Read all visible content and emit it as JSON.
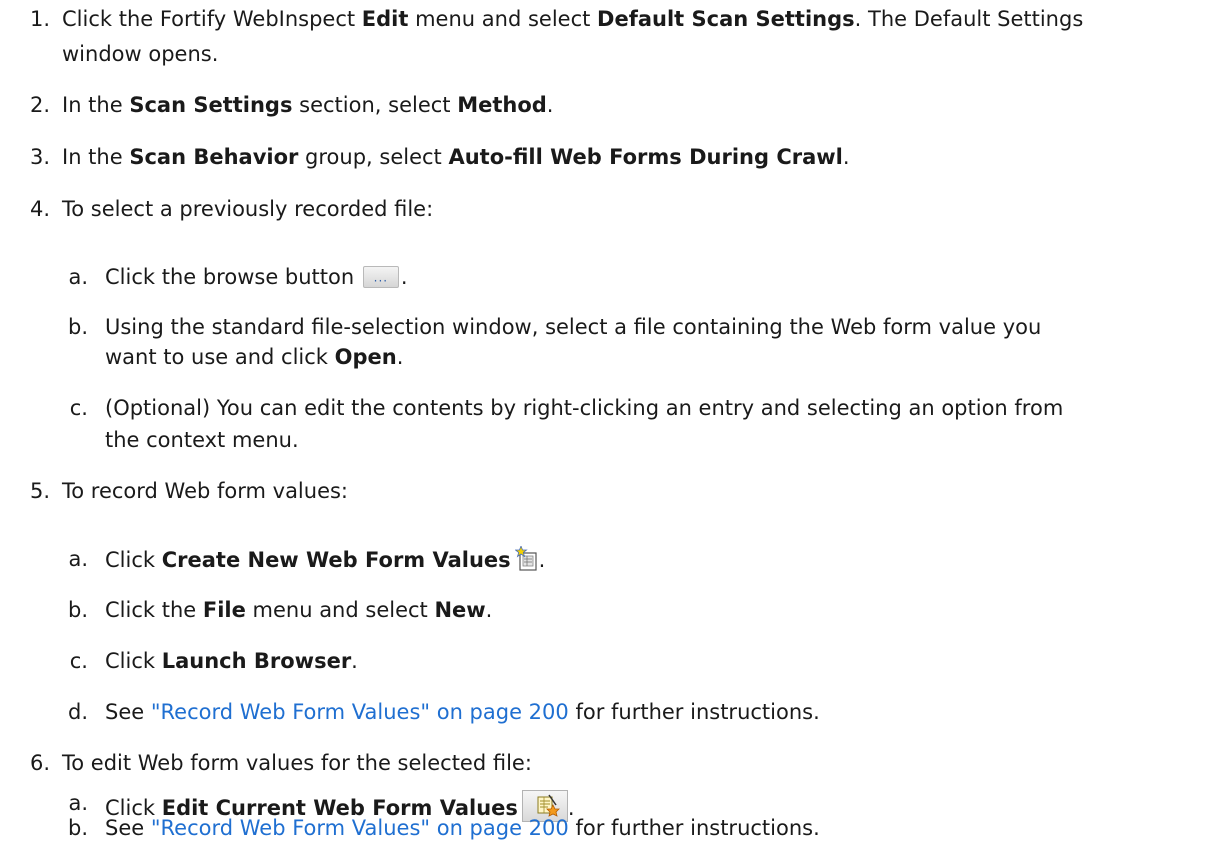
{
  "steps": {
    "s1": {
      "num": "1.",
      "p1": "Click the Fortify WebInspect ",
      "b1": "Edit",
      "p2": " menu and select ",
      "b2": "Default Scan Settings",
      "p3": ". The Default Settings",
      "cont": "window opens."
    },
    "s2": {
      "num": "2.",
      "p1": "In the ",
      "b1": "Scan Settings",
      "p2": " section, select ",
      "b2": "Method",
      "p3": "."
    },
    "s3": {
      "num": "3.",
      "p1": "In the ",
      "b1": "Scan Behavior",
      "p2": " group, select ",
      "b2": "Auto-fill Web Forms During Crawl",
      "p3": "."
    },
    "s4": {
      "num": "4.",
      "text": "To select a previously recorded file:",
      "a": {
        "letter": "a.",
        "p1": "Click the browse button ",
        "p2": "."
      },
      "b": {
        "letter": "b.",
        "p1": "Using the standard file-selection window, select a file containing the Web form value you",
        "cont1": "want to use and click ",
        "cb": "Open",
        "cont2": "."
      },
      "c": {
        "letter": "c.",
        "p1": "(Optional) You can edit the contents by right-clicking an entry and selecting an option from",
        "cont": "the context menu."
      }
    },
    "s5": {
      "num": "5.",
      "text": "To record Web form values:",
      "a": {
        "letter": "a.",
        "p1": "Click ",
        "b1": "Create New Web Form Values",
        "p2": "."
      },
      "b": {
        "letter": "b.",
        "p1": "Click the ",
        "b1": "File",
        "p2": " menu and select ",
        "b2": "New",
        "p3": "."
      },
      "c": {
        "letter": "c.",
        "p1": "Click ",
        "b1": "Launch Browser",
        "p2": "."
      },
      "d": {
        "letter": "d.",
        "p1": "See ",
        "link": "\"Record Web Form Values\" on page 200",
        "p2": " for further instructions."
      }
    },
    "s6": {
      "num": "6.",
      "text": "To edit Web form values for the selected file:",
      "a": {
        "letter": "a.",
        "p1": "Click ",
        "b1": "Edit Current Web Form Values",
        "p2": "."
      },
      "b": {
        "letter": "b.",
        "p1": "See ",
        "link": "\"Record Web Form Values\" on page 200",
        "p2": " for further instructions."
      }
    }
  },
  "icons": {
    "browse": "browse-ellipsis-icon",
    "create": "create-new-web-form-values-icon",
    "edit": "edit-current-web-form-values-icon"
  },
  "colors": {
    "link": "#1f6fd1",
    "text": "#1a1a1a"
  }
}
